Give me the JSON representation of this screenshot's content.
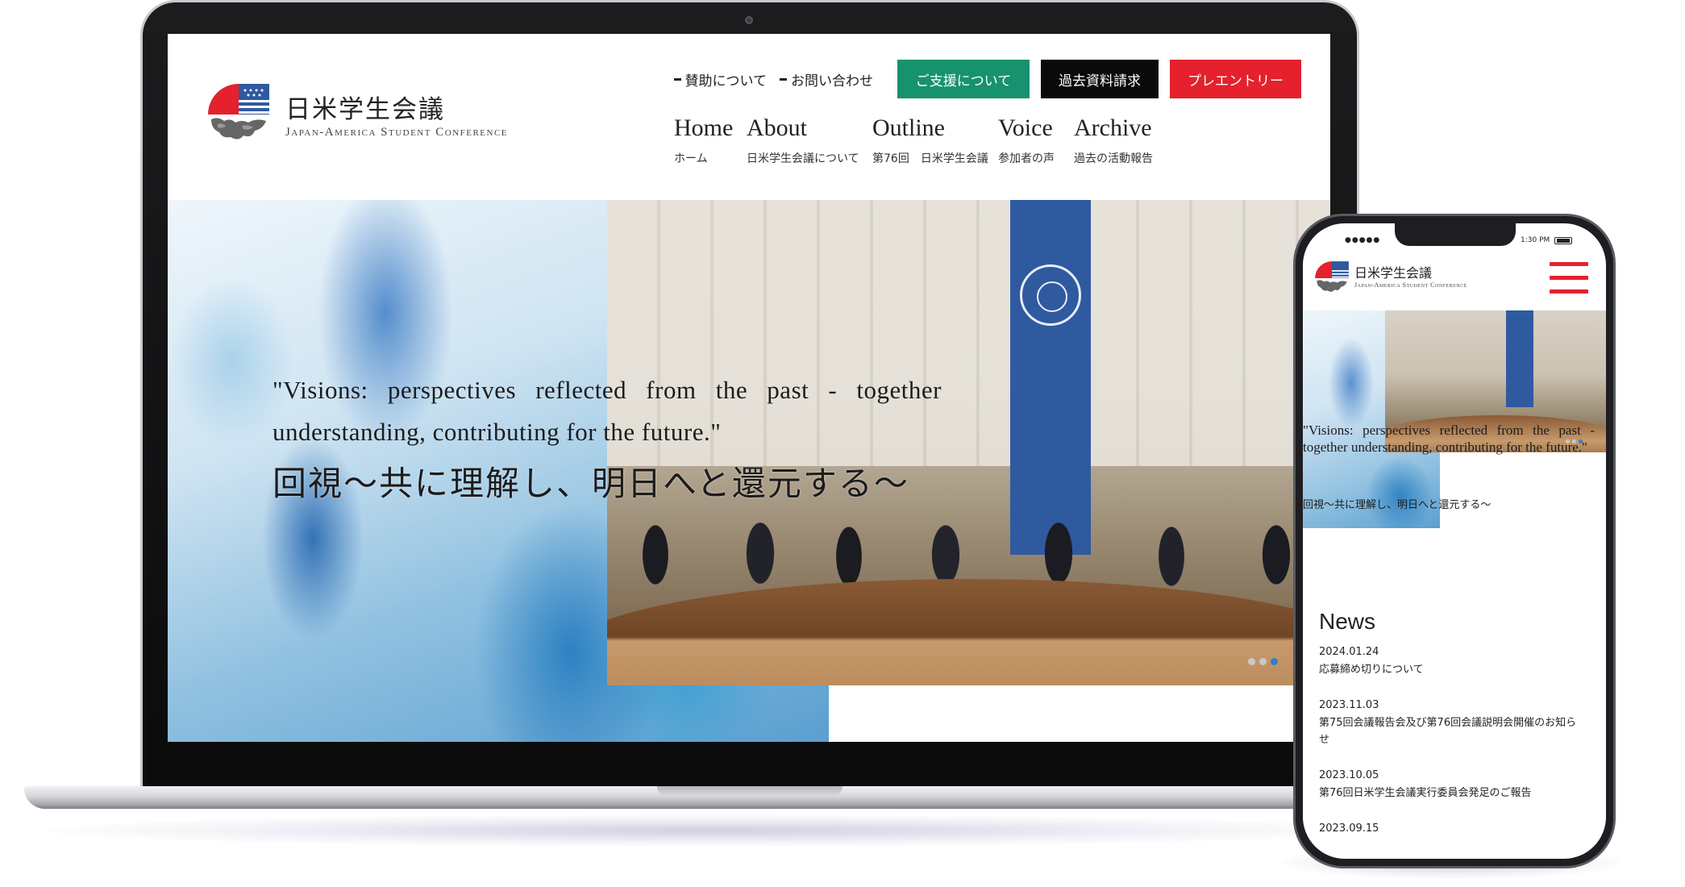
{
  "brand": {
    "name_jp": "日米学生会議",
    "name_en": "Japan-America Student Conference",
    "colors": {
      "red": "#e4212c",
      "green": "#17926f",
      "black": "#0a0a0a",
      "navy": "#2f5aa0"
    }
  },
  "header": {
    "utility_links": [
      {
        "label": "賛助について"
      },
      {
        "label": "お問い合わせ"
      }
    ],
    "buttons": {
      "support": "ご支援について",
      "materials": "過去資料請求",
      "preentry": "プレエントリー"
    }
  },
  "nav": [
    {
      "label_en": "Home",
      "label_jp": "ホーム"
    },
    {
      "label_en": "About",
      "label_jp": "日米学生会議について"
    },
    {
      "label_en": "Outline",
      "label_jp": "第76回　日米学生会議"
    },
    {
      "label_en": "Voice",
      "label_jp": "参加者の声"
    },
    {
      "label_en": "Archive",
      "label_jp": "過去の活動報告"
    }
  ],
  "hero": {
    "quote_en": "\"Visions: perspectives reflected from the past - together understanding, contributing for the future.\"",
    "quote_jp": "回視〜共に理解し、明日へと還元する〜",
    "slides": 3,
    "active_slide": 3
  },
  "phone": {
    "status": {
      "time": "1:30 PM"
    },
    "menu_icon": "hamburger-icon",
    "news": {
      "title": "News",
      "items": [
        {
          "date": "2024.01.24",
          "text": "応募締め切りについて"
        },
        {
          "date": "2023.11.03",
          "text": "第75回会議報告会及び第76回会議説明会開催のお知らせ"
        },
        {
          "date": "2023.10.05",
          "text": "第76回日米学生会議実行委員会発足のご報告"
        },
        {
          "date": "2023.09.15",
          "text": ""
        }
      ]
    }
  }
}
